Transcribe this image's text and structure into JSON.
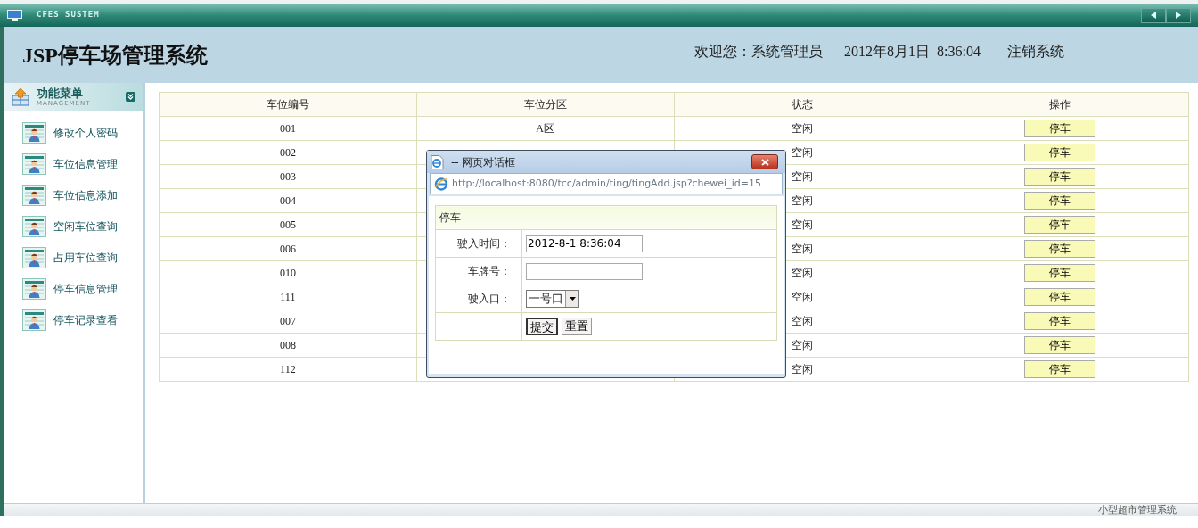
{
  "window": {
    "title": "CFES SUSTEM"
  },
  "header": {
    "title": "JSP停车场管理系统",
    "welcome": "欢迎您：系统管理员",
    "datetime": "2012年8月1日  8:36:04",
    "logout": "注销系统"
  },
  "sidebar": {
    "title": "功能菜单",
    "subtitle": "MANAGEMENT",
    "items": [
      {
        "label": "修改个人密码"
      },
      {
        "label": "车位信息管理"
      },
      {
        "label": "车位信息添加"
      },
      {
        "label": "空闲车位查询"
      },
      {
        "label": "占用车位查询"
      },
      {
        "label": "停车信息管理"
      },
      {
        "label": "停车记录查看"
      }
    ]
  },
  "table": {
    "columns": [
      "车位编号",
      "车位分区",
      "状态",
      "操作"
    ],
    "rows": [
      {
        "number": "001",
        "zone": "A区",
        "status": "空闲",
        "action": "停车"
      },
      {
        "number": "002",
        "status": "空闲",
        "action": "停车"
      },
      {
        "number": "003",
        "status": "空闲",
        "action": "停车"
      },
      {
        "number": "004",
        "status": "空闲",
        "action": "停车"
      },
      {
        "number": "005",
        "status": "空闲",
        "action": "停车"
      },
      {
        "number": "006",
        "status": "空闲",
        "action": "停车"
      },
      {
        "number": "010",
        "status": "空闲",
        "action": "停车"
      },
      {
        "number": "111",
        "status": "空闲",
        "action": "停车"
      },
      {
        "number": "007",
        "status": "空闲",
        "action": "停车"
      },
      {
        "number": "008",
        "status": "空闲",
        "action": "停车"
      },
      {
        "number": "112",
        "status": "空闲",
        "action": "停车"
      }
    ]
  },
  "dialog": {
    "title": "-- 网页对话框",
    "url": "http://localhost:8080/tcc/admin/ting/tingAdd.jsp?chewei_id=15",
    "form_title": "停车",
    "fields": [
      {
        "kind": "text",
        "label": "驶入时间：",
        "value": "2012-8-1 8:36:04"
      },
      {
        "kind": "text",
        "label": "车牌号："
      },
      {
        "kind": "select",
        "label": "驶入口：",
        "value": "一号口"
      }
    ],
    "buttons": [
      "提交",
      "重置"
    ]
  },
  "status_bar": {
    "text": "小型超市管理系统"
  }
}
